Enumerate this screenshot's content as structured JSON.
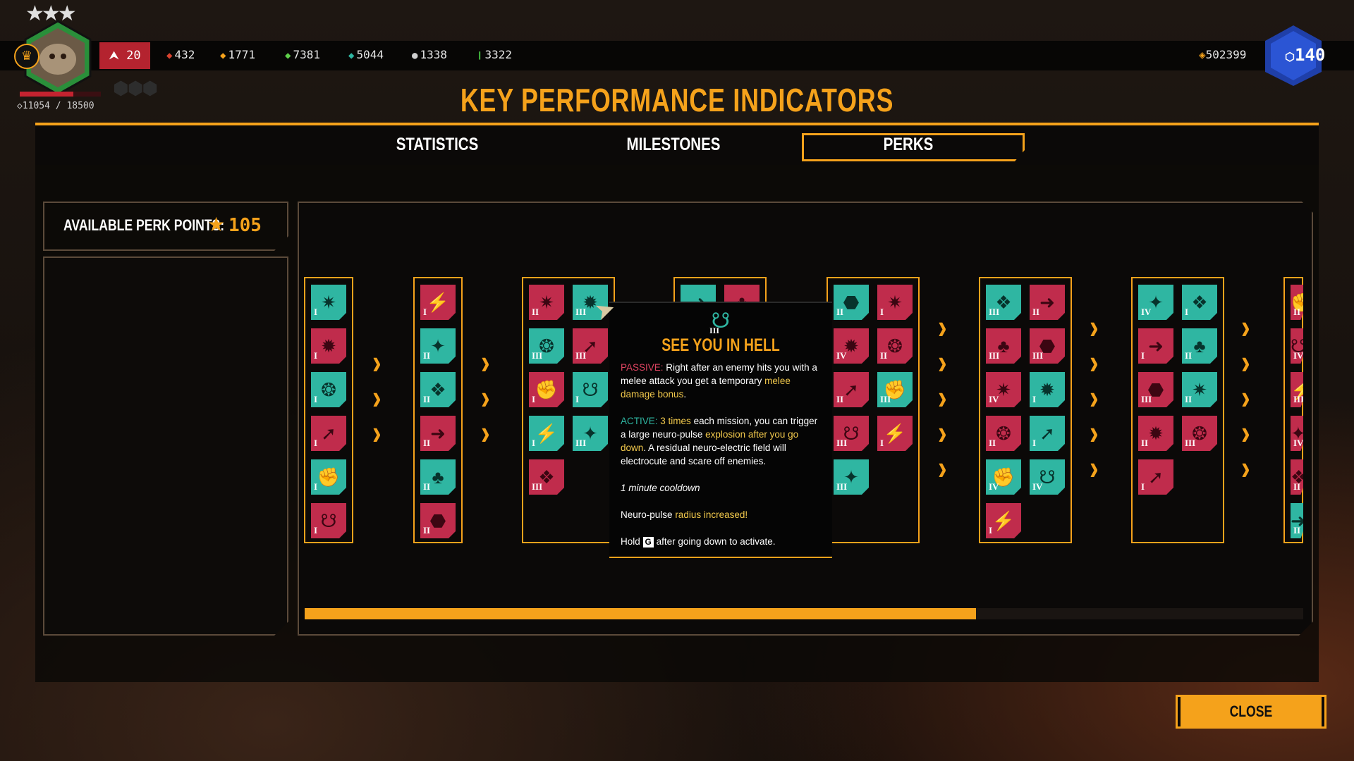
{
  "player": {
    "level": "20",
    "xp": "11054 / 18500",
    "stars": "★★★",
    "health_fraction": 0.66
  },
  "resources": [
    {
      "icon": "red-ore-icon",
      "value": "432",
      "color": "#d8432f"
    },
    {
      "icon": "gold-ore-icon",
      "value": "1771",
      "color": "#f5a21b"
    },
    {
      "icon": "green-ore-icon",
      "value": "7381",
      "color": "#5fcf4a"
    },
    {
      "icon": "teal-ore-icon",
      "value": "5044",
      "color": "#2fb6a2"
    },
    {
      "icon": "silver-ore-icon",
      "value": "1338",
      "color": "#d0d0d0"
    },
    {
      "icon": "green-gem-icon",
      "value": "3322",
      "color": "#3fae3a"
    }
  ],
  "credits": "502399",
  "shards": "140",
  "title": "KEY PERFORMANCE INDICATORS",
  "tabs": {
    "statistics": "STATISTICS",
    "milestones": "MILESTONES",
    "perks": "PERKS"
  },
  "perk_points": {
    "label": "AVAILABLE PERK POINTS:",
    "value": "105"
  },
  "perk_columns": [
    {
      "perks": [
        [
          "t",
          "I"
        ],
        [
          "r",
          "I"
        ],
        [
          "t",
          "I"
        ],
        [
          "r",
          "I"
        ],
        [
          "t",
          "I"
        ],
        [
          "r",
          "I"
        ]
      ]
    },
    {
      "perks": [
        [
          "r",
          "I"
        ],
        [
          "t",
          "II"
        ],
        [
          "t",
          "II"
        ],
        [
          "r",
          "II"
        ],
        [
          "t",
          "II"
        ],
        [
          "r",
          "II"
        ]
      ]
    },
    {
      "perks": [
        [
          "r",
          "II"
        ],
        [
          "t",
          "III"
        ],
        [
          "t",
          "III"
        ],
        [
          "r",
          "III"
        ],
        [
          "r",
          "I"
        ],
        [
          "t",
          "I"
        ],
        [
          "t",
          "I"
        ],
        [
          "t",
          "III"
        ],
        [
          "r",
          "III"
        ]
      ]
    },
    {
      "perks": [
        [
          "t",
          "II"
        ],
        [
          "r",
          "I"
        ]
      ]
    },
    {
      "perks": [
        [
          "t",
          "II"
        ],
        [
          "r",
          "I"
        ],
        [
          "r",
          "IV"
        ],
        [
          "r",
          "II"
        ],
        [
          "r",
          "II"
        ],
        [
          "t",
          "III"
        ],
        [
          "r",
          "III"
        ],
        [
          "r",
          "I"
        ],
        [
          "t",
          "III"
        ]
      ]
    },
    {
      "perks": [
        [
          "t",
          "III"
        ],
        [
          "r",
          "II"
        ],
        [
          "r",
          "III"
        ],
        [
          "r",
          "III"
        ],
        [
          "r",
          "IV"
        ],
        [
          "t",
          "I"
        ],
        [
          "r",
          "II"
        ],
        [
          "t",
          "I"
        ],
        [
          "t",
          "IV"
        ],
        [
          "t",
          "IV"
        ],
        [
          "r",
          "I"
        ]
      ]
    },
    {
      "perks": [
        [
          "t",
          "IV"
        ],
        [
          "t",
          "I"
        ],
        [
          "r",
          "I"
        ],
        [
          "t",
          "II"
        ],
        [
          "r",
          "III"
        ],
        [
          "t",
          "II"
        ],
        [
          "r",
          "II"
        ],
        [
          "r",
          "III"
        ],
        [
          "r",
          "I"
        ]
      ]
    },
    {
      "perks": [
        [
          "r",
          "II"
        ],
        [
          "r",
          "IV"
        ],
        [
          "r",
          "III"
        ],
        [
          "r",
          "IV"
        ],
        [
          "r",
          "II"
        ],
        [
          "t",
          "II"
        ]
      ]
    }
  ],
  "progress_fraction": 0.672,
  "tooltip": {
    "rank": "III",
    "title": "SEE YOU IN HELL",
    "passive_label": "PASSIVE:",
    "passive_text_1": "Right after an enemy hits you with a melee attack you get a temporary",
    "passive_hl": "melee damage bonus",
    "passive_end": ".",
    "active_label": "ACTIVE:",
    "active_hl_1": "3 times",
    "active_text_1": "each mission, you can trigger a large neuro-pulse",
    "active_hl_2": "explosion after you go down",
    "active_text_2": ". A residual neuro-electric field will electrocute and scare off enemies.",
    "cooldown": "1 minute cooldown",
    "upgrade_text": "Neuro-pulse",
    "upgrade_hl": "radius increased!",
    "hold_text": "Hold",
    "hold_key": "G",
    "hold_end": "after going down to activate."
  },
  "close_label": "CLOSE"
}
